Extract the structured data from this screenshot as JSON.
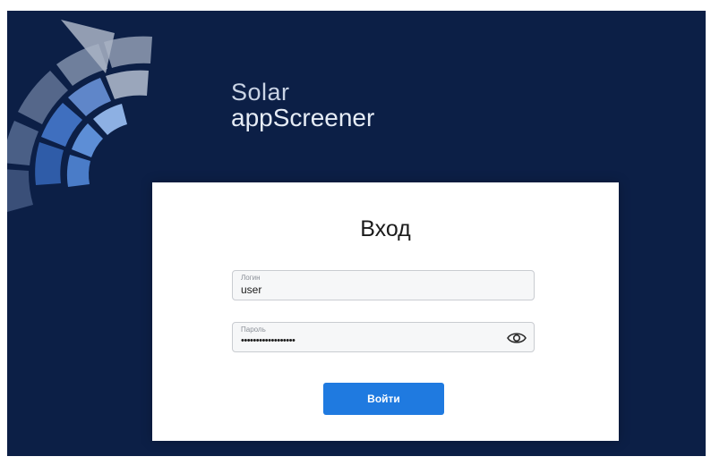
{
  "brand": {
    "line1": "Solar",
    "line2": "appScreener"
  },
  "login_form": {
    "title": "Вход",
    "login": {
      "label": "Логин",
      "value": "user"
    },
    "password": {
      "label": "Пароль",
      "value": "••••••••••••••••••"
    },
    "submit_label": "Войти"
  },
  "icons": {
    "password_toggle": "eye-icon",
    "logo": "solar-logo-icon"
  },
  "colors": {
    "background": "#0c1f46",
    "button": "#1f7ae0",
    "card": "#ffffff"
  }
}
